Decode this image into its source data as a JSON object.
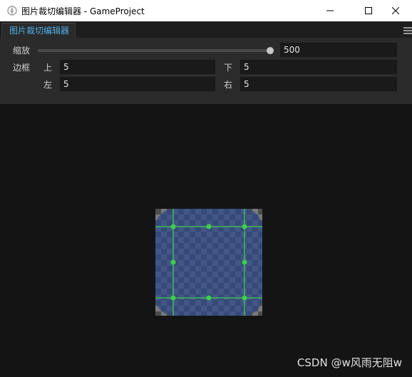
{
  "window": {
    "title": "图片裁切编辑器 - GameProject"
  },
  "tabs": [
    {
      "label": "图片裁切编辑器",
      "active": true
    }
  ],
  "zoom": {
    "label": "缩放",
    "value": "500",
    "slider_fraction": 1.0
  },
  "border": {
    "label": "边框",
    "top_label": "上",
    "top_value": "5",
    "bottom_label": "下",
    "bottom_value": "5",
    "left_label": "左",
    "left_value": "5",
    "right_label": "右",
    "right_value": "5"
  },
  "colors": {
    "accent": "#4fb0e8",
    "guide": "#3ecf4a",
    "image_fill": "#2a3a5e"
  },
  "watermark": "CSDN @w风雨无阻w"
}
